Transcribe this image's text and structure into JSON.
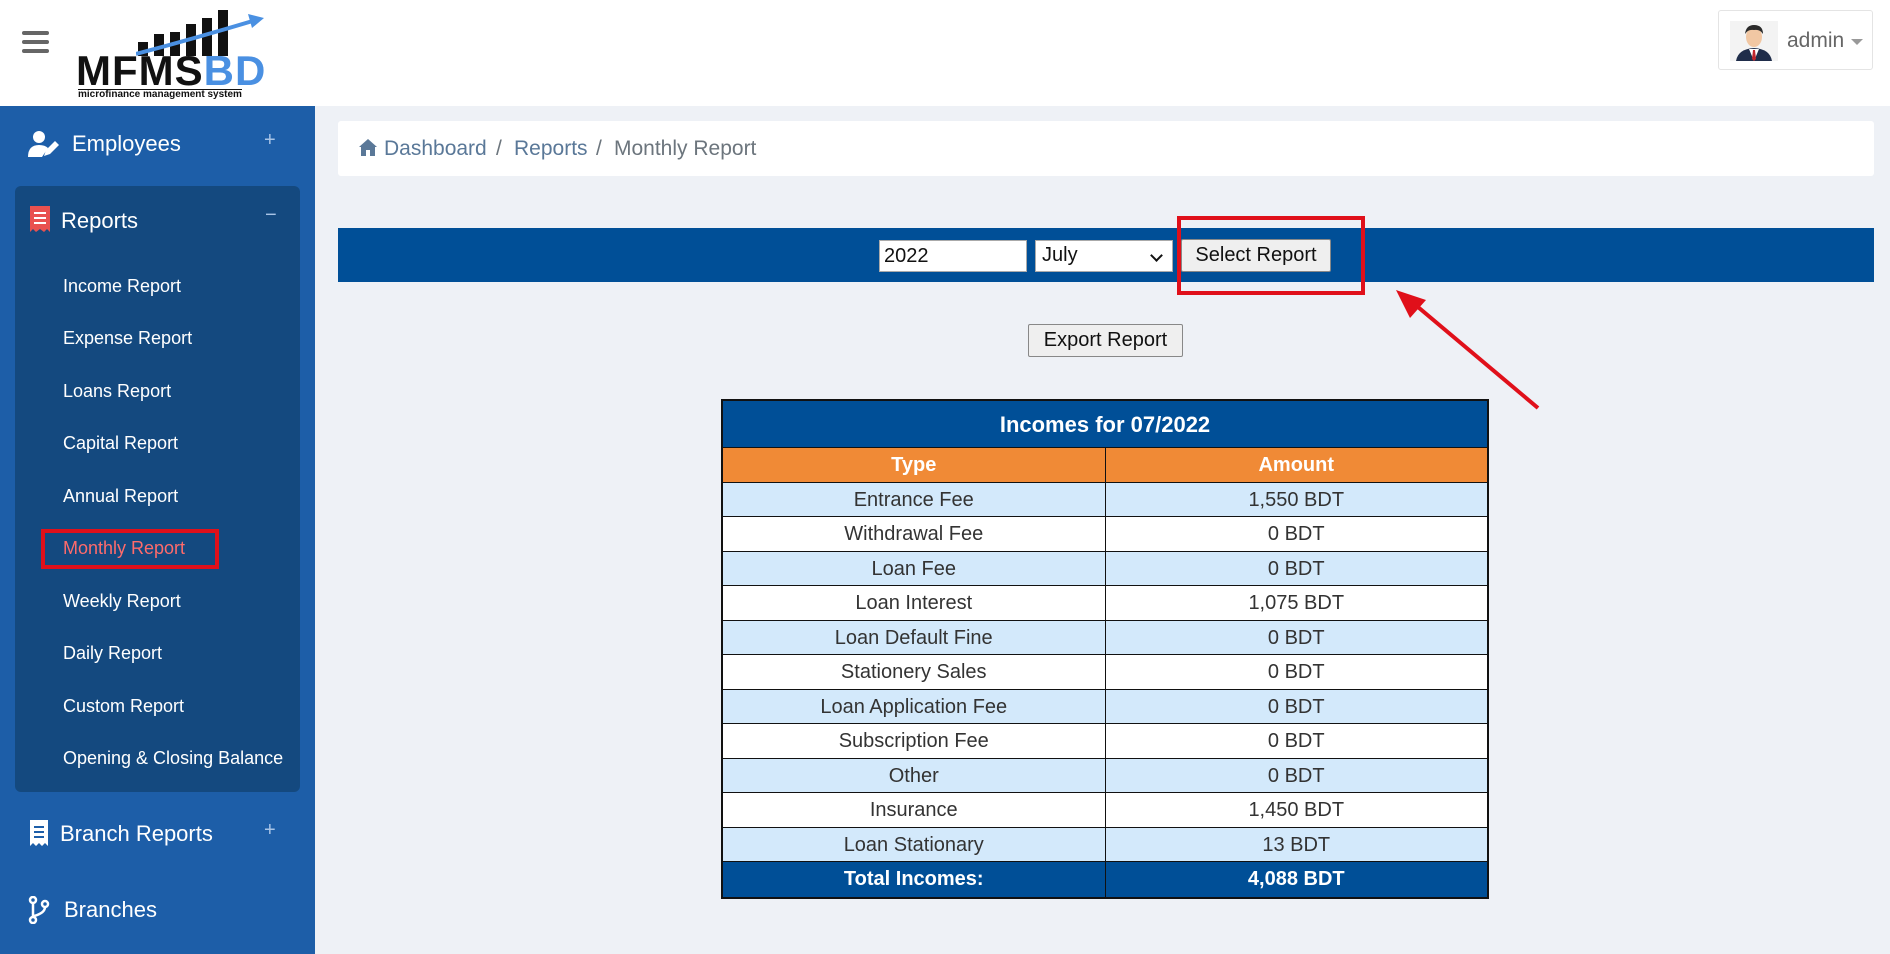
{
  "header": {
    "logo_main": "MFMS",
    "logo_accent": "BD",
    "logo_tagline": "microfinance management system",
    "user_name": "admin"
  },
  "sidebar": {
    "employees": {
      "label": "Employees",
      "toggle": "+"
    },
    "reports": {
      "label": "Reports",
      "toggle": "−",
      "items": [
        {
          "label": "Income Report"
        },
        {
          "label": "Expense Report"
        },
        {
          "label": "Loans Report"
        },
        {
          "label": "Capital Report"
        },
        {
          "label": "Annual Report"
        },
        {
          "label": "Monthly Report",
          "active": true
        },
        {
          "label": "Weekly Report"
        },
        {
          "label": "Daily Report"
        },
        {
          "label": "Custom Report"
        },
        {
          "label": "Opening & Closing Balance"
        }
      ]
    },
    "branch_reports": {
      "label": "Branch Reports",
      "toggle": "+"
    },
    "branches": {
      "label": "Branches"
    }
  },
  "breadcrumb": {
    "items": [
      "Dashboard",
      "Reports",
      "Monthly Report"
    ],
    "separator": "/"
  },
  "filters": {
    "year_value": "2022",
    "month_value": "July",
    "select_label": "Select Report",
    "export_label": "Export Report"
  },
  "table": {
    "title": "Incomes for 07/2022",
    "columns": [
      "Type",
      "Amount"
    ],
    "rows": [
      {
        "type": "Entrance Fee",
        "amount": "1,550 BDT"
      },
      {
        "type": "Withdrawal Fee",
        "amount": "0 BDT"
      },
      {
        "type": "Loan Fee",
        "amount": "0 BDT"
      },
      {
        "type": "Loan Interest",
        "amount": "1,075 BDT"
      },
      {
        "type": "Loan Default Fine",
        "amount": "0 BDT"
      },
      {
        "type": "Stationery Sales",
        "amount": "0 BDT"
      },
      {
        "type": "Loan Application Fee",
        "amount": "0 BDT"
      },
      {
        "type": "Subscription Fee",
        "amount": "0 BDT"
      },
      {
        "type": "Other",
        "amount": "0 BDT"
      },
      {
        "type": "Insurance",
        "amount": "1,450 BDT"
      },
      {
        "type": "Loan Stationary",
        "amount": "13 BDT"
      }
    ],
    "total_label": "Total Incomes:",
    "total_value": "4,088 BDT"
  },
  "colors": {
    "sidebar": "#1d5ea8",
    "primary": "#004f97",
    "table_header": "#f08a36",
    "row_alt": "#d3e9fb",
    "highlight": "#e0101a",
    "active_text": "#ff6b6b"
  },
  "icons": {
    "menu": "hamburger-icon",
    "employees": "user-edit-icon",
    "reports": "receipt-icon",
    "branch_reports": "receipt-icon",
    "branches": "code-branch-icon",
    "home": "home-icon"
  }
}
